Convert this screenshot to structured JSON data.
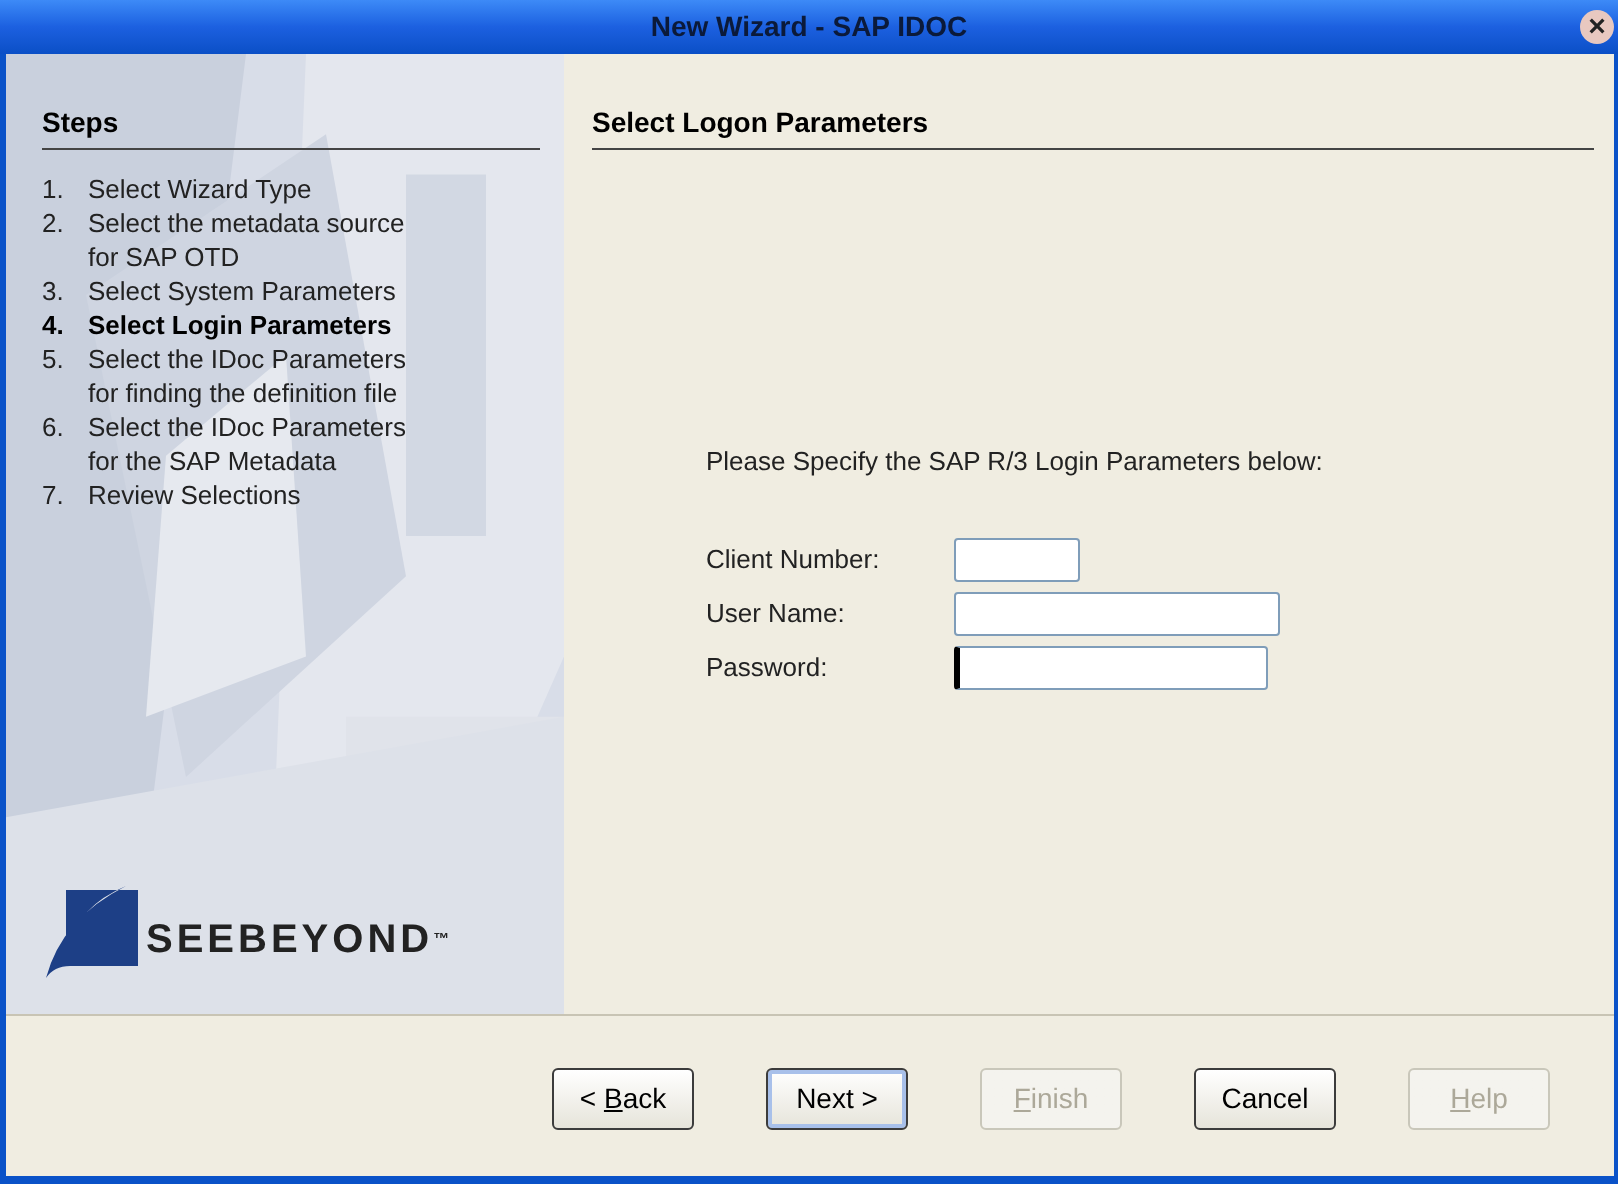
{
  "window": {
    "title": "New Wizard - SAP IDOC",
    "close": "×"
  },
  "steps": {
    "title": "Steps",
    "items": [
      {
        "number": "1.",
        "label": "Select Wizard Type",
        "selected": false
      },
      {
        "number": "2.",
        "label": "Select the metadata source for SAP OTD",
        "selected": false
      },
      {
        "number": "3.",
        "label": "Select System Parameters",
        "selected": false
      },
      {
        "number": "4.",
        "label": "Select Login Parameters",
        "selected": true
      },
      {
        "number": "5.",
        "label": "Select the IDoc Parameters for finding the definition file",
        "selected": false
      },
      {
        "number": "6.",
        "label": "Select the IDoc Parameters for the SAP Metadata",
        "selected": false
      },
      {
        "number": "7.",
        "label": "Review Selections",
        "selected": false
      }
    ]
  },
  "logo": {
    "text": "SEEBEYOND",
    "mark": "™"
  },
  "content": {
    "title": "Select Logon Parameters",
    "instruction": "Please Specify the SAP R/3 Login Parameters below:",
    "fields": [
      {
        "label": "Client Number:",
        "kind": "short",
        "focused": false
      },
      {
        "label": "User Name:",
        "kind": "long",
        "focused": false
      },
      {
        "label": "Password:",
        "kind": "medium",
        "focused": true
      }
    ]
  },
  "buttons": [
    {
      "before": "< ",
      "key": "B",
      "after": "ack",
      "disabled": false,
      "default": false
    },
    {
      "before": "Next >",
      "disabled": false,
      "default": true
    },
    {
      "key": "F",
      "after": "inish",
      "disabled": true,
      "default": false
    },
    {
      "before": "Cancel",
      "disabled": false,
      "default": false
    },
    {
      "key": "H",
      "after": "elp",
      "disabled": true,
      "default": false
    }
  ]
}
